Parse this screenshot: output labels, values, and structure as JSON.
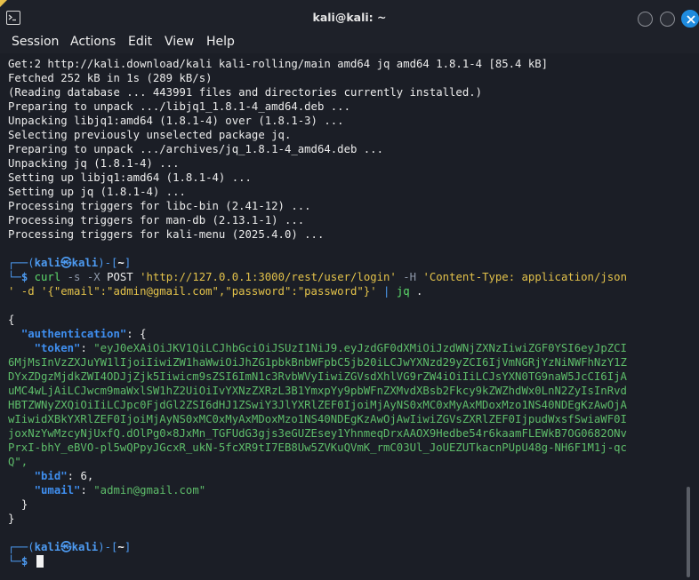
{
  "window": {
    "title": "kali@kali: ~",
    "colors": {
      "titlebar": "#1e2129",
      "terminal_bg": "#1b1e26",
      "close_button": "#1f8bde"
    }
  },
  "menu": [
    "Session",
    "Actions",
    "Edit",
    "View",
    "Help"
  ],
  "output_lines": [
    "Get:2 http://kali.download/kali kali-rolling/main amd64 jq amd64 1.8.1-4 [85.4 kB]",
    "Fetched 252 kB in 1s (289 kB/s)",
    "(Reading database ... 443991 files and directories currently installed.)",
    "Preparing to unpack .../libjq1_1.8.1-4_amd64.deb ...",
    "Unpacking libjq1:amd64 (1.8.1-4) over (1.8.1-3) ...",
    "Selecting previously unselected package jq.",
    "Preparing to unpack .../archives/jq_1.8.1-4_amd64.deb ...",
    "Unpacking jq (1.8.1-4) ...",
    "Setting up libjq1:amd64 (1.8.1-4) ...",
    "Setting up jq (1.8.1-4) ...",
    "Processing triggers for libc-bin (2.41-12) ...",
    "Processing triggers for man-db (2.13.1-1) ...",
    "Processing triggers for kali-menu (2025.4.0) ..."
  ],
  "prompt": {
    "open": "┌──(",
    "user": "kali",
    "at": "㉿",
    "host": "kali",
    "close": ")-[",
    "dir": "~",
    "end": "]",
    "corner": "└─",
    "symbol": "$"
  },
  "command": {
    "program": "curl",
    "flags1": " -s -X ",
    "method": "POST",
    "url": " 'http://127.0.0.1:3000/rest/user/login'",
    "header_flag": " -H ",
    "header": "'Content-Type: application/json",
    "cont1": "' -d '",
    "body": "{\"email\":\"admin@gmail.com\",\"password\":\"password\"}",
    "cont2": "'",
    "pipe": " | ",
    "pipe_cmd": "jq",
    "tail": " ."
  },
  "json_output": {
    "open_brace": "{",
    "auth_key": "\"authentication\"",
    "auth_open": ": {",
    "token_key": "\"token\"",
    "token_lines": [
      "\"eyJ0eXAiOiJKV1QiLCJhbGciOiJSUzI1NiJ9.eyJzdGF0dXMiOiJzdWNjZXNzIiwiZGF0YSI6eyJpZCI",
      "6MjMsInVzZXJuYW1lIjoiIiwiZW1haWwiOiJhZG1pbkBnbWFpbC5jb20iLCJwYXNzd29yZCI6IjVmNGRjYzNiNWFhNzY1Z",
      "DYxZDgzMjdkZWI4ODJjZjk5Iiwicm9sZSI6ImN1c3RvbWVyIiwiZGVsdXhlVG9rZW4iOiIiLCJsYXN0TG9naW5JcCI6IjA",
      "uMC4wLjAiLCJwcm9maWxlSW1hZ2UiOiIvYXNzZXRzL3B1YmxpYy9pbWFnZXMvdXBsb2Fkcy9kZWZhdWx0LnN2ZyIsInRvd",
      "HBTZWNyZXQiOiIiLCJpc0FjdGl2ZSI6dHJ1ZSwiY3JlYXRlZEF0IjoiMjAyNS0xMC0xMyAxMDoxMzo1NS40NDEgKzAwOjA",
      "wIiwidXBkYXRlZEF0IjoiMjAyNS0xMC0xMyAxMDoxMzo1NS40NDEgKzAwOjAwIiwiZGVsZXRlZEF0IjpudWxsfSwiaWF0I",
      "joxNzYwMzcyNjUxfQ.dOlPg0×8JxMn_TGFUdG3gjs3eGUZEsey1YhnmeqDrxAAOX9Hedbe54r6kaamFLEWkB7OG0682ONv",
      "PrxI-bhY_eBVO-pl5wQPpyJGcxR_ukN-5fcXR9tI7EB8Uw5ZVKuQVmK_rmC03Ul_JoUEZUTkacnPUpU48g-NH6F1M1j-qc",
      "Q\","
    ],
    "bid_key": "\"bid\"",
    "bid_value": "6,",
    "umail_key": "\"umail\"",
    "umail_value": "\"admin@gmail.com\"",
    "inner_close": "}",
    "outer_close": "}"
  }
}
